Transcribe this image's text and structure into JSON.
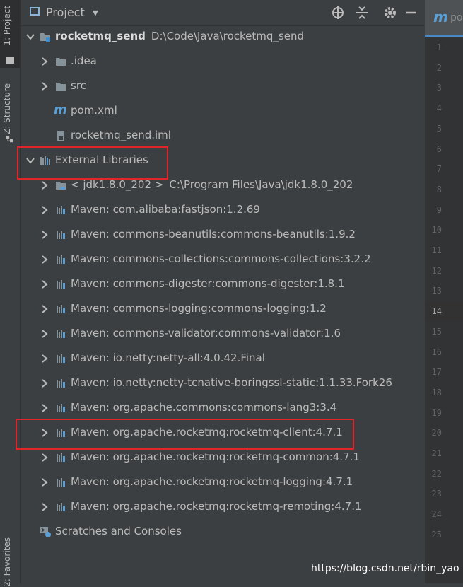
{
  "sidebar": {
    "project_tab": "1: Project",
    "structure_tab": "Z: Structure",
    "favorites_tab": "2: Favorites"
  },
  "header": {
    "title": "Project",
    "dropdown_glyph": "▾"
  },
  "editor": {
    "tab_prefix": "m",
    "tab_title": "po",
    "line_numbers": [
      "1",
      "2",
      "3",
      "4",
      "5",
      "6",
      "7",
      "8",
      "9",
      "10",
      "11",
      "12",
      "13",
      "14",
      "15",
      "16",
      "17",
      "18",
      "19",
      "20",
      "21",
      "22",
      "23",
      "24",
      "25"
    ],
    "current_line": "14"
  },
  "tree": {
    "root": {
      "name": "rocketmq_send",
      "path": "D:\\Code\\Java\\rocketmq_send"
    },
    "idea": ".idea",
    "src": "src",
    "pom": "pom.xml",
    "iml": "rocketmq_send.iml",
    "external": "External Libraries",
    "jdk": {
      "name": "< jdk1.8.0_202 >",
      "path": "C:\\Program Files\\Java\\jdk1.8.0_202"
    },
    "libs": [
      "Maven: com.alibaba:fastjson:1.2.69",
      "Maven: commons-beanutils:commons-beanutils:1.9.2",
      "Maven: commons-collections:commons-collections:3.2.2",
      "Maven: commons-digester:commons-digester:1.8.1",
      "Maven: commons-logging:commons-logging:1.2",
      "Maven: commons-validator:commons-validator:1.6",
      "Maven: io.netty:netty-all:4.0.42.Final",
      "Maven: io.netty:netty-tcnative-boringssl-static:1.1.33.Fork26",
      "Maven: org.apache.commons:commons-lang3:3.4",
      "Maven: org.apache.rocketmq:rocketmq-client:4.7.1",
      "Maven: org.apache.rocketmq:rocketmq-common:4.7.1",
      "Maven: org.apache.rocketmq:rocketmq-logging:4.7.1",
      "Maven: org.apache.rocketmq:rocketmq-remoting:4.7.1"
    ],
    "scratches": "Scratches and Consoles"
  },
  "watermark": "https://blog.csdn.net/rbin_yao",
  "colors": {
    "background": "#3c3f41",
    "selection": "#0d293e",
    "highlight_box": "#e0262b",
    "folder": "#87939a",
    "maven_accent": "#5a9fd6"
  }
}
